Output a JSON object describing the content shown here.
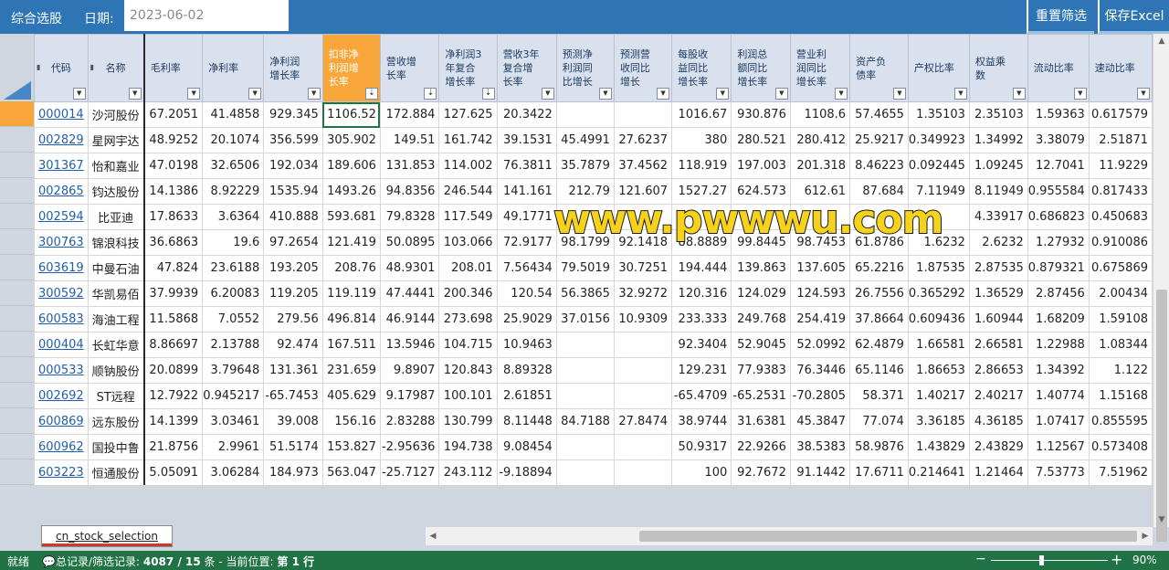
{
  "header": {
    "title": "综合选股",
    "date_label": "日期:",
    "date_value": "2023-06-02",
    "reset_button": "重置筛选",
    "save_button": "保存Excel"
  },
  "table": {
    "columns": [
      {
        "label": "代码",
        "sorted": false
      },
      {
        "label": "名称",
        "sorted": false
      },
      {
        "label": "毛利率",
        "sorted": false
      },
      {
        "label": "净利率",
        "sorted": false
      },
      {
        "label": "净利润增长率",
        "sorted": false
      },
      {
        "label": "扣非净利润增长率",
        "sorted": true
      },
      {
        "label": "营收增长率",
        "sorted": true
      },
      {
        "label": "净利润3年复合增长率",
        "sorted": true
      },
      {
        "label": "营收3年复合增长率",
        "sorted": false
      },
      {
        "label": "预测净利润同比增长",
        "sorted": false
      },
      {
        "label": "预测营收同比增长",
        "sorted": false
      },
      {
        "label": "每股收益同比增长率",
        "sorted": false
      },
      {
        "label": "利润总额同比增长率",
        "sorted": false
      },
      {
        "label": "营业利润同比增长率",
        "sorted": false
      },
      {
        "label": "资产负债率",
        "sorted": false
      },
      {
        "label": "产权比率",
        "sorted": false
      },
      {
        "label": "权益乘数",
        "sorted": false
      },
      {
        "label": "流动比率",
        "sorted": false
      },
      {
        "label": "速动比率",
        "sorted": false
      }
    ],
    "rows": [
      [
        "000014",
        "沙河股份",
        "67.2051",
        "41.4858",
        "929.345",
        "1106.52",
        "172.884",
        "127.625",
        "20.3422",
        "",
        "",
        "1016.67",
        "930.876",
        "1108.6",
        "57.4655",
        "1.35103",
        "2.35103",
        "1.59363",
        "0.617579"
      ],
      [
        "002829",
        "星网宇达",
        "48.9252",
        "20.1074",
        "356.599",
        "305.902",
        "149.51",
        "161.742",
        "39.1531",
        "45.4991",
        "27.6237",
        "380",
        "280.521",
        "280.412",
        "25.9217",
        "0.349923",
        "1.34992",
        "3.38079",
        "2.51871"
      ],
      [
        "301367",
        "怡和嘉业",
        "47.0198",
        "32.6506",
        "192.034",
        "189.606",
        "131.853",
        "114.002",
        "76.3811",
        "35.7879",
        "37.4562",
        "118.919",
        "197.003",
        "201.318",
        "8.46223",
        "0.092445",
        "1.09245",
        "12.7041",
        "11.9229"
      ],
      [
        "002865",
        "钧达股份",
        "14.1386",
        "8.92229",
        "1535.94",
        "1493.26",
        "94.8356",
        "246.544",
        "141.161",
        "212.79",
        "121.607",
        "1527.27",
        "624.573",
        "612.61",
        "87.684",
        "7.11949",
        "8.11949",
        "0.955584",
        "0.817433"
      ],
      [
        "002594",
        "比亚迪",
        "17.8633",
        "3.6364",
        "410.888",
        "593.681",
        "79.8328",
        "117.549",
        "49.1771",
        "",
        "",
        "",
        "",
        "",
        "",
        "",
        "4.33917",
        "0.686823",
        "0.450683"
      ],
      [
        "300763",
        "锦浪科技",
        "36.6863",
        "19.6",
        "97.2654",
        "121.419",
        "50.0895",
        "103.066",
        "72.9177",
        "98.1799",
        "92.1418",
        "88.8889",
        "99.8445",
        "98.7453",
        "61.8786",
        "1.6232",
        "2.6232",
        "1.27932",
        "0.910086"
      ],
      [
        "603619",
        "中曼石油",
        "47.824",
        "23.6188",
        "193.205",
        "208.76",
        "48.9301",
        "208.01",
        "7.56434",
        "79.5019",
        "30.7251",
        "194.444",
        "139.863",
        "137.605",
        "65.2216",
        "1.87535",
        "2.87535",
        "0.879321",
        "0.675869"
      ],
      [
        "300592",
        "华凯易佰",
        "37.9939",
        "6.20083",
        "119.205",
        "119.119",
        "47.4441",
        "200.346",
        "120.54",
        "56.3865",
        "32.9272",
        "120.316",
        "124.029",
        "124.593",
        "26.7556",
        "0.365292",
        "1.36529",
        "2.87456",
        "2.00434"
      ],
      [
        "600583",
        "海油工程",
        "11.5868",
        "7.0552",
        "279.56",
        "496.814",
        "46.9144",
        "273.698",
        "25.9029",
        "37.0156",
        "10.9309",
        "233.333",
        "249.768",
        "254.419",
        "37.8664",
        "0.609436",
        "1.60944",
        "1.68209",
        "1.59108"
      ],
      [
        "000404",
        "长虹华意",
        "8.86697",
        "2.13788",
        "92.474",
        "167.511",
        "13.5946",
        "104.715",
        "10.9463",
        "",
        "",
        "92.3404",
        "52.9045",
        "52.0992",
        "62.4879",
        "1.66581",
        "2.66581",
        "1.22988",
        "1.08344"
      ],
      [
        "000533",
        "顺钠股份",
        "20.0899",
        "3.79648",
        "131.361",
        "231.659",
        "9.8907",
        "120.843",
        "8.89328",
        "",
        "",
        "129.231",
        "77.9383",
        "76.3446",
        "65.1146",
        "1.86653",
        "2.86653",
        "1.34392",
        "1.122"
      ],
      [
        "002692",
        "ST远程",
        "12.7922",
        "0.945217",
        "-65.7453",
        "405.629",
        "9.17987",
        "100.101",
        "2.61851",
        "",
        "",
        "-65.4709",
        "-65.2531",
        "-70.2805",
        "58.371",
        "1.40217",
        "2.40217",
        "1.40774",
        "1.15168"
      ],
      [
        "600869",
        "远东股份",
        "14.1399",
        "3.03461",
        "39.008",
        "156.16",
        "2.83288",
        "130.799",
        "8.11448",
        "84.7188",
        "27.8474",
        "38.9744",
        "31.6381",
        "45.3847",
        "77.074",
        "3.36185",
        "4.36185",
        "1.07417",
        "0.855595"
      ],
      [
        "600962",
        "国投中鲁",
        "21.8756",
        "2.9961",
        "51.5174",
        "153.827",
        "-2.95636",
        "194.738",
        "9.08454",
        "",
        "",
        "50.9317",
        "22.9266",
        "38.5383",
        "58.9876",
        "1.43829",
        "2.43829",
        "1.12567",
        "0.573408"
      ],
      [
        "603223",
        "恒通股份",
        "5.05091",
        "3.06284",
        "184.973",
        "563.047",
        "-25.7127",
        "243.112",
        "-9.18894",
        "",
        "",
        "100",
        "92.7672",
        "91.1442",
        "17.6711",
        "0.214641",
        "1.21464",
        "7.53773",
        "7.51962"
      ]
    ]
  },
  "watermark": "www.pwwwu.com",
  "sheet_tab": "cn_stock_selection",
  "status": {
    "ready": "就绪",
    "records_label": "总记录/筛选记录:",
    "records_value": "4087 / 15",
    "records_unit": "条 - 当前位置:",
    "position_value": "第 1 行",
    "zoom": "90%"
  },
  "colors": {
    "ribbon": "#2e75b6",
    "highlight": "#f7a73a",
    "status_bar": "#217346",
    "link": "#1f5fae"
  }
}
